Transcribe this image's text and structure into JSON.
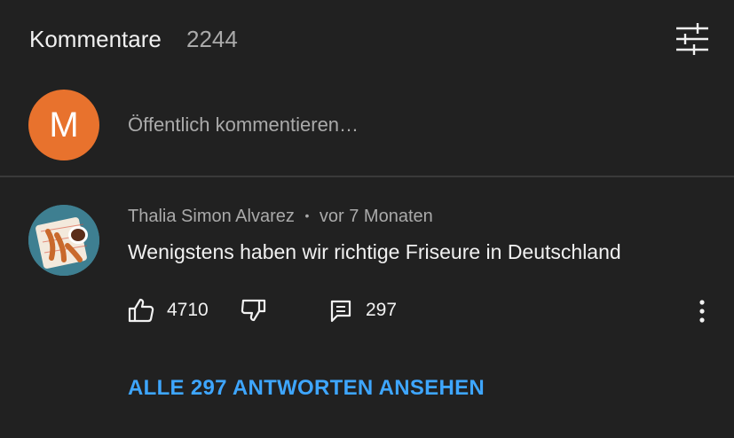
{
  "header": {
    "title": "Kommentare",
    "count": "2244",
    "sort_icon": "sliders-icon"
  },
  "add_comment": {
    "avatar_letter": "M",
    "avatar_color": "#e8722d",
    "placeholder": "Öffentlich kommentieren…"
  },
  "comment": {
    "author": "Thalia Simon Alvarez",
    "separator": "•",
    "time": "vor 7 Monaten",
    "text": "Wenigstens haben wir richtige Friseure in Deutschland",
    "likes": "4710",
    "replies_count": "297",
    "view_replies_label": "ALLE 297 ANTWORTEN ANSEHEN",
    "like_icon": "thumbs-up-icon",
    "dislike_icon": "thumbs-down-icon",
    "reply_icon": "reply-icon",
    "more_icon": "more-vertical-icon"
  },
  "colors": {
    "background": "#212121",
    "link": "#3ea6ff",
    "secondary_text": "#aaaaaa"
  }
}
